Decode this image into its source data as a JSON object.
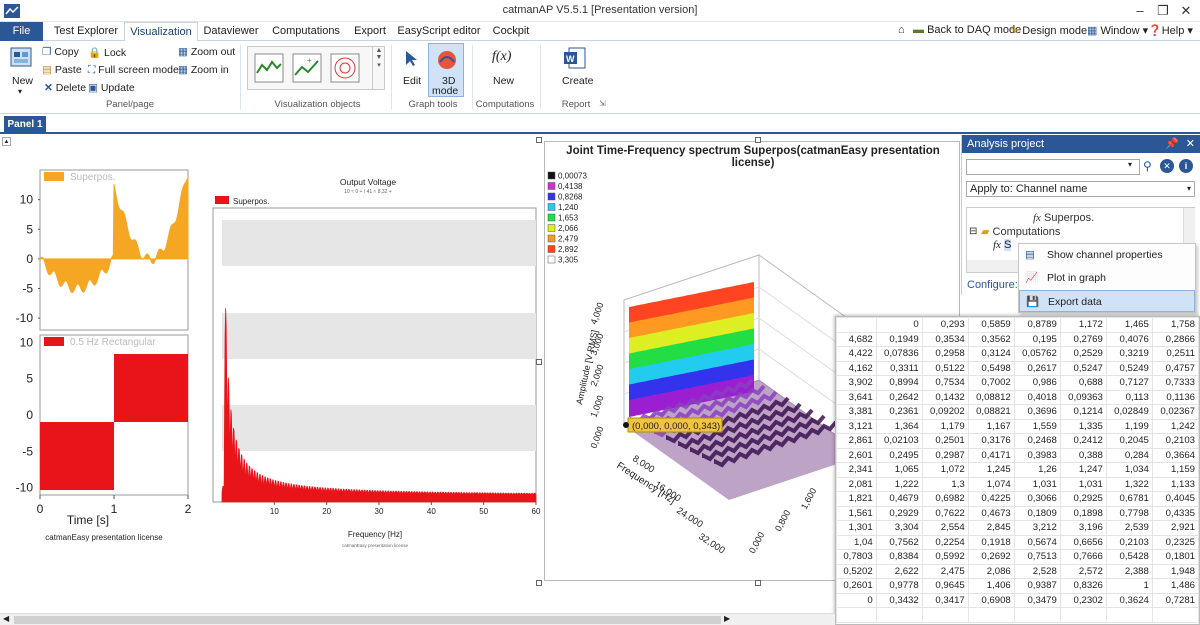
{
  "window": {
    "title": "catmanAP V5.5.1 [Presentation version]",
    "min": "–",
    "restore": "❐",
    "close": "✕"
  },
  "tabs": {
    "file": "File",
    "items": [
      "Test Explorer",
      "Visualization",
      "Dataviewer",
      "Computations",
      "Export",
      "EasyScript editor",
      "Cockpit"
    ],
    "active": "Visualization"
  },
  "toplinks": {
    "back": "Back to DAQ mode",
    "design": "Design mode",
    "window": "Window",
    "help": "Help"
  },
  "ribbon": {
    "panel_page": {
      "new": "New",
      "copy": "Copy",
      "paste": "Paste",
      "delete": "Delete",
      "lock": "Lock",
      "fullscreen": "Full screen mode",
      "update": "Update",
      "zoom_out": "Zoom out",
      "zoom_in": "Zoom in",
      "group": "Panel/page"
    },
    "vis_objects": {
      "group": "Visualization objects"
    },
    "graph_tools": {
      "edit": "Edit",
      "mode3d": "3D",
      "mode3d2": "mode",
      "group": "Graph tools"
    },
    "computations": {
      "new": "New",
      "fx": "f(x)",
      "group": "Computations"
    },
    "report": {
      "create": "Create",
      "group": "Report"
    }
  },
  "panel_tab": "Panel 1",
  "chart_data": [
    {
      "type": "line",
      "legend": "Superpos.",
      "yticks": [
        "10",
        "5",
        "0",
        "-5",
        "-10"
      ],
      "ylim": [
        -12,
        15
      ],
      "color": "#f5a623"
    },
    {
      "type": "area",
      "legend": "0.5 Hz Rectangular",
      "yticks": [
        "10",
        "5",
        "0",
        "-5",
        "-10"
      ],
      "xticks": [
        "0",
        "1",
        "2"
      ],
      "xlabel": "Time  [s]",
      "footer": "catmanEasy presentation license",
      "color": "#e8141a",
      "ylim": [
        -11,
        11
      ]
    },
    {
      "type": "line",
      "title": "Output Voltage",
      "subtitle": "10 ≈ 0 + / 41 ≈ 8,32 +",
      "legend": "Superpos.",
      "xlabel": "Frequency  [Hz]",
      "xticks": [
        "10",
        "20",
        "30",
        "40",
        "50",
        "60"
      ],
      "footer": "catmanEasy presentation license",
      "color": "#e8141a"
    },
    {
      "type": "heatmap",
      "title": "Joint Time-Frequency spectrum Superpos(catmanEasy presentation license)",
      "legend": [
        "0,00073",
        "0,4138",
        "0,8268",
        "1,240",
        "1,653",
        "2,066",
        "2,479",
        "2,892",
        "3,305"
      ],
      "legend_colors": [
        "#111111",
        "#cc33cc",
        "#3333ee",
        "#22ccee",
        "#22dd44",
        "#ddee22",
        "#ff9922",
        "#ff4422",
        "#ffffff"
      ],
      "zlabel": "Amplitude [V RMS]",
      "ylabel": "Frequency [Hz]",
      "zticks": [
        "4,000",
        "3,000",
        "2,000",
        "1,000",
        "0,000"
      ],
      "yticks": [
        "8,000",
        "16,000",
        "24,000",
        "32,000"
      ],
      "xticks": [
        "1,600",
        "0,800",
        "0,000"
      ],
      "tooltip": "(0,000, 0,000, 0,343)"
    }
  ],
  "analysis": {
    "title": "Analysis project",
    "apply": "Apply to: Channel name",
    "tree": {
      "superpos": "Superpos.",
      "computations": "Computations",
      "node": "S"
    },
    "configure": "Configure: 3"
  },
  "context_menu": [
    "Show channel properties",
    "Plot in graph",
    "Export data"
  ],
  "table": {
    "header": [
      "",
      "0",
      "0,293",
      "0,5859",
      "0,8789",
      "1,172",
      "1,465",
      "1,758"
    ],
    "rows": [
      [
        "4,682",
        "0,1949",
        "0,3534",
        "0,3562",
        "0,195",
        "0,2769",
        "0,4076",
        "0,2866"
      ],
      [
        "4,422",
        "0,07836",
        "0,2958",
        "0,3124",
        "0,05762",
        "0,2529",
        "0,3219",
        "0,2511"
      ],
      [
        "4,162",
        "0,3311",
        "0,5122",
        "0,5498",
        "0,2617",
        "0,5247",
        "0,5249",
        "0,4757"
      ],
      [
        "3,902",
        "0,8994",
        "0,7534",
        "0,7002",
        "0,986",
        "0,688",
        "0,7127",
        "0,7333"
      ],
      [
        "3,641",
        "0,2642",
        "0,1432",
        "0,08812",
        "0,4018",
        "0,09363",
        "0,113",
        "0,1136"
      ],
      [
        "3,381",
        "0,2361",
        "0,09202",
        "0,08821",
        "0,3696",
        "0,1214",
        "0,02849",
        "0,02367"
      ],
      [
        "3,121",
        "1,364",
        "1,179",
        "1,167",
        "1,559",
        "1,335",
        "1,199",
        "1,242"
      ],
      [
        "2,861",
        "0,02103",
        "0,2501",
        "0,3176",
        "0,2468",
        "0,2412",
        "0,2045",
        "0,2103"
      ],
      [
        "2,601",
        "0,2495",
        "0,2987",
        "0,4171",
        "0,3983",
        "0,388",
        "0,284",
        "0,3664"
      ],
      [
        "2,341",
        "1,065",
        "1,072",
        "1,245",
        "1,26",
        "1,247",
        "1,034",
        "1,159"
      ],
      [
        "2,081",
        "1,222",
        "1,3",
        "1,074",
        "1,031",
        "1,031",
        "1,322",
        "1,133"
      ],
      [
        "1,821",
        "0,4679",
        "0,6982",
        "0,4225",
        "0,3066",
        "0,2925",
        "0,6781",
        "0,4045"
      ],
      [
        "1,561",
        "0,2929",
        "0,7622",
        "0,4673",
        "0,1809",
        "0,1898",
        "0,7798",
        "0,4335"
      ],
      [
        "1,301",
        "3,304",
        "2,554",
        "2,845",
        "3,212",
        "3,196",
        "2,539",
        "2,921"
      ],
      [
        "1,04",
        "0,7562",
        "0,2254",
        "0,1918",
        "0,5674",
        "0,6656",
        "0,2103",
        "0,2325"
      ],
      [
        "0,7803",
        "0,8384",
        "0,5992",
        "0,2692",
        "0,7513",
        "0,7666",
        "0,5428",
        "0,1801"
      ],
      [
        "0,5202",
        "2,622",
        "2,475",
        "2,086",
        "2,528",
        "2,572",
        "2,388",
        "1,948"
      ],
      [
        "0,2601",
        "0,9778",
        "0,9645",
        "1,406",
        "0,9387",
        "0,8326",
        "1",
        "1,486"
      ],
      [
        "0",
        "0,3432",
        "0,3417",
        "0,6908",
        "0,3479",
        "0,2302",
        "0,3624",
        "0,7281"
      ]
    ]
  }
}
